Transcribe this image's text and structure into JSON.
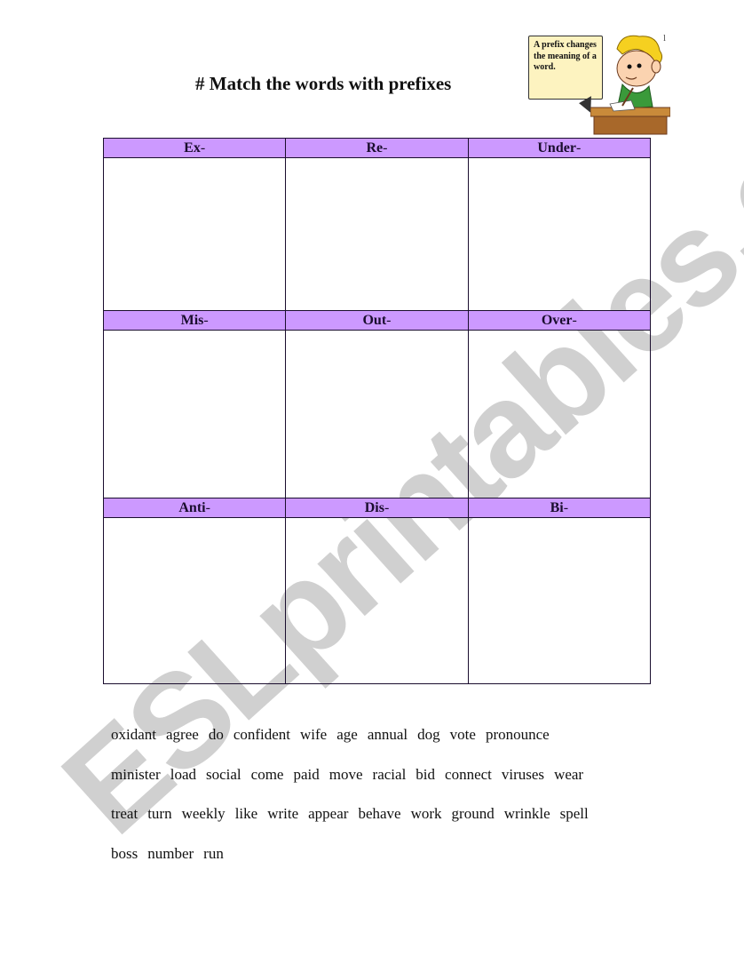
{
  "watermark": "ESLprintables.com",
  "title": "# Match the words with prefixes",
  "illustration": {
    "bubble_text": "A prefix changes the meaning of a word.",
    "corner_mark": "l"
  },
  "colors": {
    "header_bg": "#cc99ff",
    "border": "#1a0d2e",
    "watermark": "#c8c8c8"
  },
  "prefix_table": {
    "rows": [
      [
        "Ex",
        "Re",
        "Under"
      ],
      [
        "Mis",
        "Out",
        "Over"
      ],
      [
        "Anti",
        "Dis",
        "Bi"
      ]
    ],
    "suffix_mark": "-"
  },
  "word_bank": {
    "lines": [
      [
        "oxidant",
        "agree",
        "do",
        "confident",
        "wife",
        "age",
        "annual",
        "dog",
        "vote",
        "pronounce"
      ],
      [
        "minister",
        "load",
        "social",
        "come",
        "paid",
        "move",
        "racial",
        "bid",
        "connect",
        "viruses",
        "wear"
      ],
      [
        "treat",
        "turn",
        "weekly",
        "like",
        "write",
        "appear",
        "behave",
        "work",
        "ground",
        "wrinkle",
        "spell"
      ],
      [
        "boss",
        "number",
        "run"
      ]
    ]
  }
}
